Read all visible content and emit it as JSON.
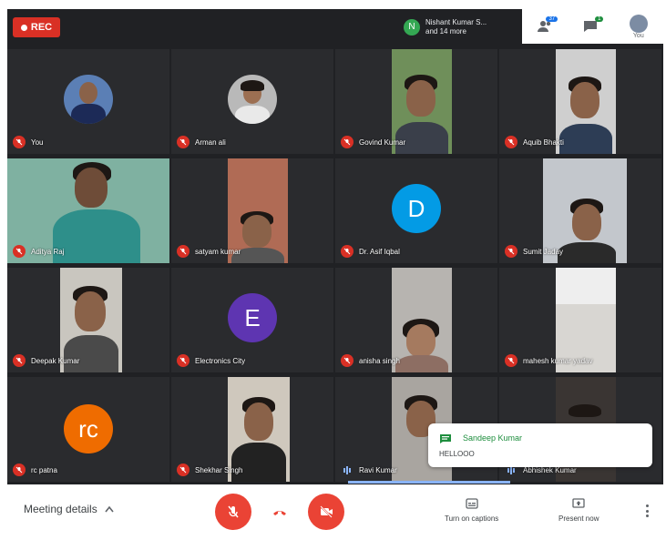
{
  "recording": {
    "label": "REC"
  },
  "presenter": {
    "initial": "N",
    "line1": "Nishant Kumar S...",
    "line2": "and 14 more"
  },
  "topright": {
    "participants_count": "37",
    "chat_badge": "1",
    "self_label": "You"
  },
  "tiles": [
    {
      "name": "You",
      "mic": "muted"
    },
    {
      "name": "Arman ali",
      "mic": "muted"
    },
    {
      "name": "Govind Kumar",
      "mic": "muted"
    },
    {
      "name": "Aquib Bhakti",
      "mic": "muted"
    },
    {
      "name": "Aditya Raj",
      "mic": "muted"
    },
    {
      "name": "satyam kumar",
      "mic": "muted"
    },
    {
      "name": "Dr. Asif Iqbal",
      "mic": "muted",
      "initial": "D",
      "color": "#039be5"
    },
    {
      "name": "Sumit Jaday",
      "mic": "muted"
    },
    {
      "name": "Deepak Kumar",
      "mic": "muted"
    },
    {
      "name": "Electronics City",
      "mic": "muted",
      "initial": "E",
      "color": "#5e35b1"
    },
    {
      "name": "anisha singh",
      "mic": "muted"
    },
    {
      "name": "mahesh kumar yadav",
      "mic": "muted"
    },
    {
      "name": "rc patna",
      "mic": "muted",
      "initial": "rc",
      "color": "#ef6c00"
    },
    {
      "name": "Shekhar Singh",
      "mic": "muted"
    },
    {
      "name": "Ravi Kumar",
      "mic": "speaking"
    },
    {
      "name": "Abhishek Kumar",
      "mic": "speaking"
    }
  ],
  "chat": {
    "sender": "Sandeep Kumar",
    "message": "HELLOOO"
  },
  "bottombar": {
    "meeting_details": "Meeting details",
    "captions": "Turn on captions",
    "present": "Present now"
  },
  "colors": {
    "mute_red": "#ea4335",
    "accent_blue": "#1a73e8",
    "chat_green": "#1e8e3e"
  }
}
